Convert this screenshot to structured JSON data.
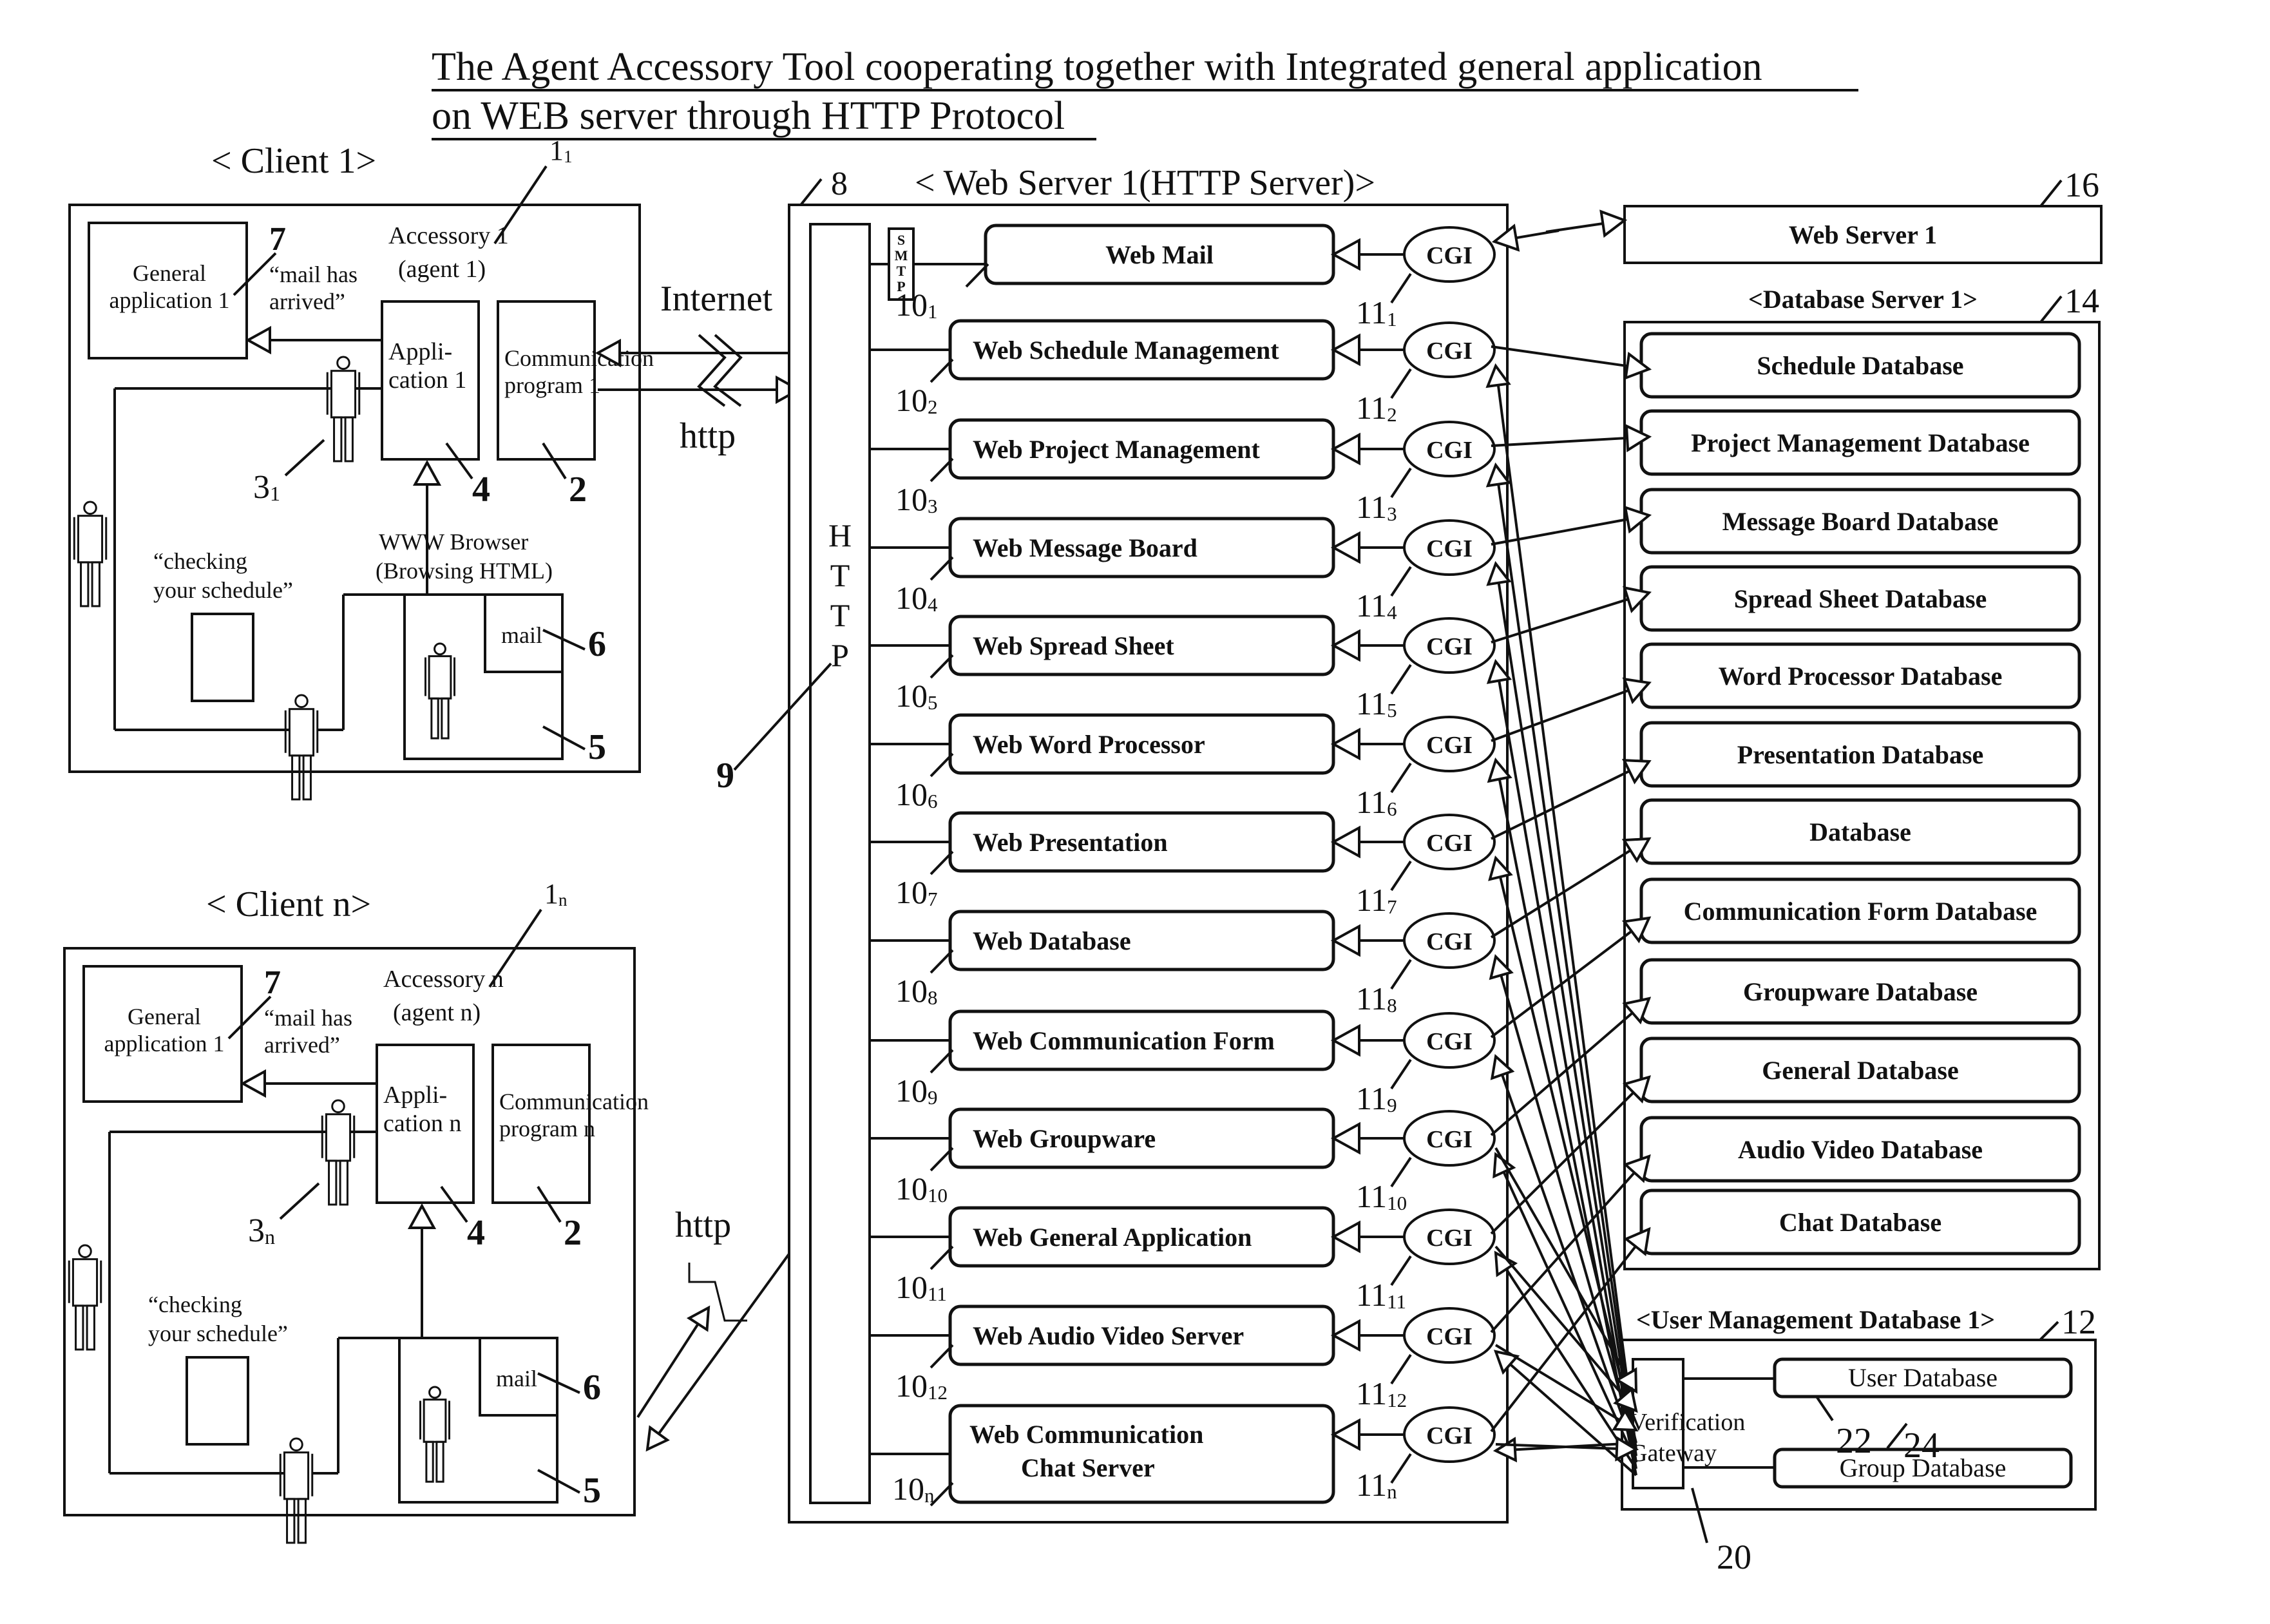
{
  "title": {
    "line1": "The Agent Accessory Tool cooperating together with Integrated  general  application",
    "line2": "on WEB server through HTTP Protocol"
  },
  "clients": [
    {
      "heading": "< Client 1>",
      "ref_accessory": "1",
      "ref_accessory_sub": "1",
      "general_app": [
        "General",
        "application 1"
      ],
      "ref_general": "7",
      "mail_msg": [
        "“mail has",
        "arrived”"
      ],
      "accessory": [
        "Accessory 1",
        "(agent 1)"
      ],
      "application": [
        "Appli-",
        "cation 1"
      ],
      "ref_application": "4",
      "comm_program": [
        "Communication",
        "program 1"
      ],
      "ref_comm": "2",
      "ref_user": "3",
      "ref_user_sub": "1",
      "checking_msg": [
        "“checking",
        "your schedule”"
      ],
      "browser": [
        "WWW Browser",
        "(Browsing HTML)"
      ],
      "mail_label": "mail",
      "ref_mail": "6",
      "ref_browser": "5"
    },
    {
      "heading": "< Client n>",
      "ref_accessory": "1",
      "ref_accessory_sub": "n",
      "general_app": [
        "General",
        "application 1"
      ],
      "ref_general": "7",
      "mail_msg": [
        "“mail has",
        "arrived”"
      ],
      "accessory": [
        "Accessory n",
        "(agent n)"
      ],
      "application": [
        "Appli-",
        "cation n"
      ],
      "ref_application": "4",
      "comm_program": [
        "Communication",
        "program n"
      ],
      "ref_comm": "2",
      "ref_user": "3",
      "ref_user_sub": "n",
      "checking_msg": [
        "“checking",
        "your schedule”"
      ],
      "browser": [
        "",
        ""
      ],
      "mail_label": "mail",
      "ref_mail": "6",
      "ref_browser": "5"
    }
  ],
  "network": {
    "internet_label": "Internet",
    "http_label_1": "http",
    "http_label_n": "http"
  },
  "web_server": {
    "heading": "< Web Server  1(HTTP Server)>",
    "ref": "8",
    "http_bar_letters": [
      "H",
      "T",
      "T",
      "P"
    ],
    "ref_http": "9",
    "smtp_letters": [
      "S",
      "M",
      "T",
      "P"
    ],
    "cgi_label": "CGI",
    "apps": [
      {
        "name": [
          "Web Mail"
        ],
        "ref": "10",
        "sub": "1",
        "cgi_ref": "11",
        "cgi_sub": "1"
      },
      {
        "name": [
          "Web Schedule Management"
        ],
        "ref": "10",
        "sub": "2",
        "cgi_ref": "11",
        "cgi_sub": "2"
      },
      {
        "name": [
          "Web Project Management"
        ],
        "ref": "10",
        "sub": "3",
        "cgi_ref": "11",
        "cgi_sub": "3"
      },
      {
        "name": [
          "Web Message Board"
        ],
        "ref": "10",
        "sub": "4",
        "cgi_ref": "11",
        "cgi_sub": "4"
      },
      {
        "name": [
          "Web Spread Sheet"
        ],
        "ref": "10",
        "sub": "5",
        "cgi_ref": "11",
        "cgi_sub": "5"
      },
      {
        "name": [
          "Web Word Processor"
        ],
        "ref": "10",
        "sub": "6",
        "cgi_ref": "11",
        "cgi_sub": "6"
      },
      {
        "name": [
          "Web Presentation"
        ],
        "ref": "10",
        "sub": "7",
        "cgi_ref": "11",
        "cgi_sub": "7"
      },
      {
        "name": [
          "Web Database"
        ],
        "ref": "10",
        "sub": "8",
        "cgi_ref": "11",
        "cgi_sub": "8"
      },
      {
        "name": [
          "Web Communication Form"
        ],
        "ref": "10",
        "sub": "9",
        "cgi_ref": "11",
        "cgi_sub": "9"
      },
      {
        "name": [
          "Web Groupware"
        ],
        "ref": "10",
        "sub": "10",
        "cgi_ref": "11",
        "cgi_sub": "10"
      },
      {
        "name": [
          "Web General Application"
        ],
        "ref": "10",
        "sub": "11",
        "cgi_ref": "11",
        "cgi_sub": "11"
      },
      {
        "name": [
          "Web Audio Video Server"
        ],
        "ref": "10",
        "sub": "12",
        "cgi_ref": "11",
        "cgi_sub": "12"
      },
      {
        "name": [
          "Web Communication",
          "Chat Server"
        ],
        "ref": "10",
        "sub": "n",
        "cgi_ref": "11",
        "cgi_sub": "n"
      }
    ]
  },
  "web_server_16": {
    "label": "Web Server 1",
    "ref": "16"
  },
  "database_server": {
    "heading": "<Database Server 1>",
    "ref": "14",
    "databases": [
      "Schedule Database",
      "Project Management Database",
      "Message Board Database",
      "Spread Sheet Database",
      "Word Processor Database",
      "Presentation Database",
      "Database",
      "Communication Form Database",
      "Groupware Database",
      "General Database",
      "Audio Video Database",
      "Chat Database"
    ]
  },
  "user_mgmt": {
    "heading": "<User Management Database 1>",
    "ref": "12",
    "gateway": [
      "Verification",
      "Gateway"
    ],
    "ref_gateway": "20",
    "user_db": "User Database",
    "ref_user_db": "22",
    "group_db": "Group Database",
    "ref_group_db": "24"
  }
}
